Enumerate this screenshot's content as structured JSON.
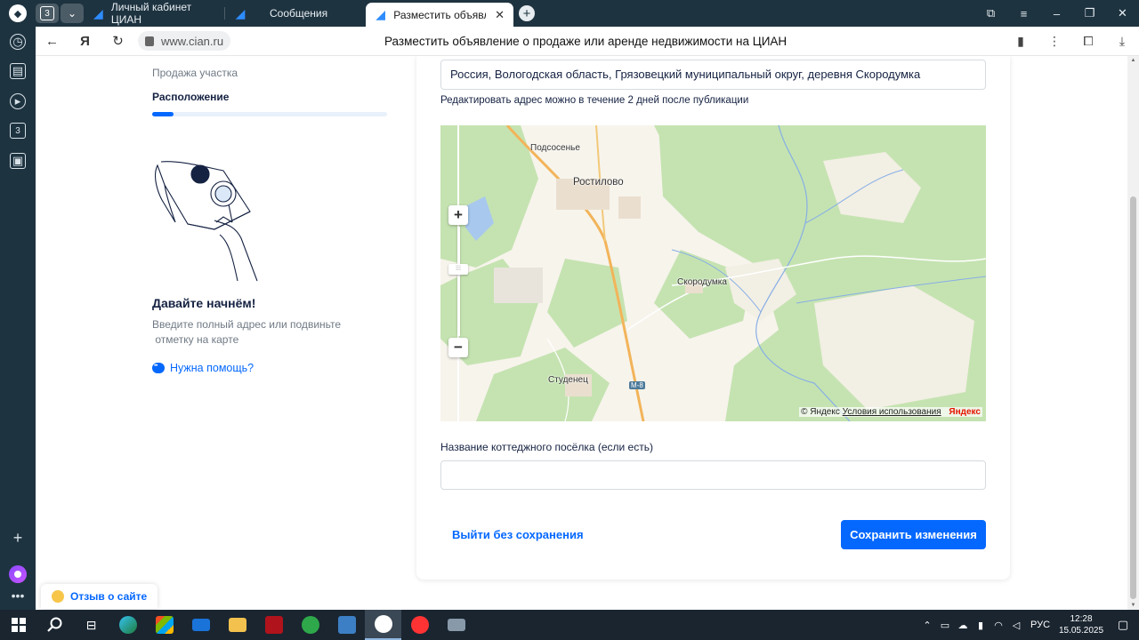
{
  "browser": {
    "tab_count": "3",
    "tabs": [
      {
        "label": "Личный кабинет ЦИАН"
      },
      {
        "label": "Сообщения"
      },
      {
        "label": "Разместить объявлени"
      }
    ],
    "url": "www.cian.ru",
    "page_title": "Разместить объявление о продаже или аренде недвижимости на ЦИАН",
    "sidebar_badge": "3"
  },
  "left": {
    "step_prev": "Продажа участка",
    "step_current": "Расположение",
    "progress_fraction": 0.09,
    "heading": "Давайте начнём!",
    "hint_line1": "Введите полный адрес или подвиньте",
    "hint_line2": " отметку на карте",
    "help_link": "Нужна помощь?"
  },
  "form": {
    "address_value": "Россия, Вологодская область, Грязовецкий муниципальный округ, деревня Скородумка",
    "address_note": "Редактировать адрес можно в течение 2 дней после публикации",
    "map": {
      "labels": [
        "Подсосенье",
        "Ростилово",
        "Скородумка",
        "Студенец"
      ],
      "road": "М-8",
      "copyright": "© Яндекс",
      "terms": "Условия использования",
      "brand": "Яндекс"
    },
    "cottage_label": "Название коттеджного посёлка (если есть)",
    "cottage_value": "",
    "exit_label": "Выйти без сохранения",
    "save_label": "Сохранить изменения"
  },
  "feedback_label": "Отзыв о сайте",
  "system": {
    "lang": "РУС",
    "time": "12:28",
    "date": "15.05.2025"
  },
  "colors": {
    "accent": "#0468ff",
    "chrome": "#1e3340",
    "map_forest": "#c5e3b1",
    "map_road": "#f2b45a"
  }
}
